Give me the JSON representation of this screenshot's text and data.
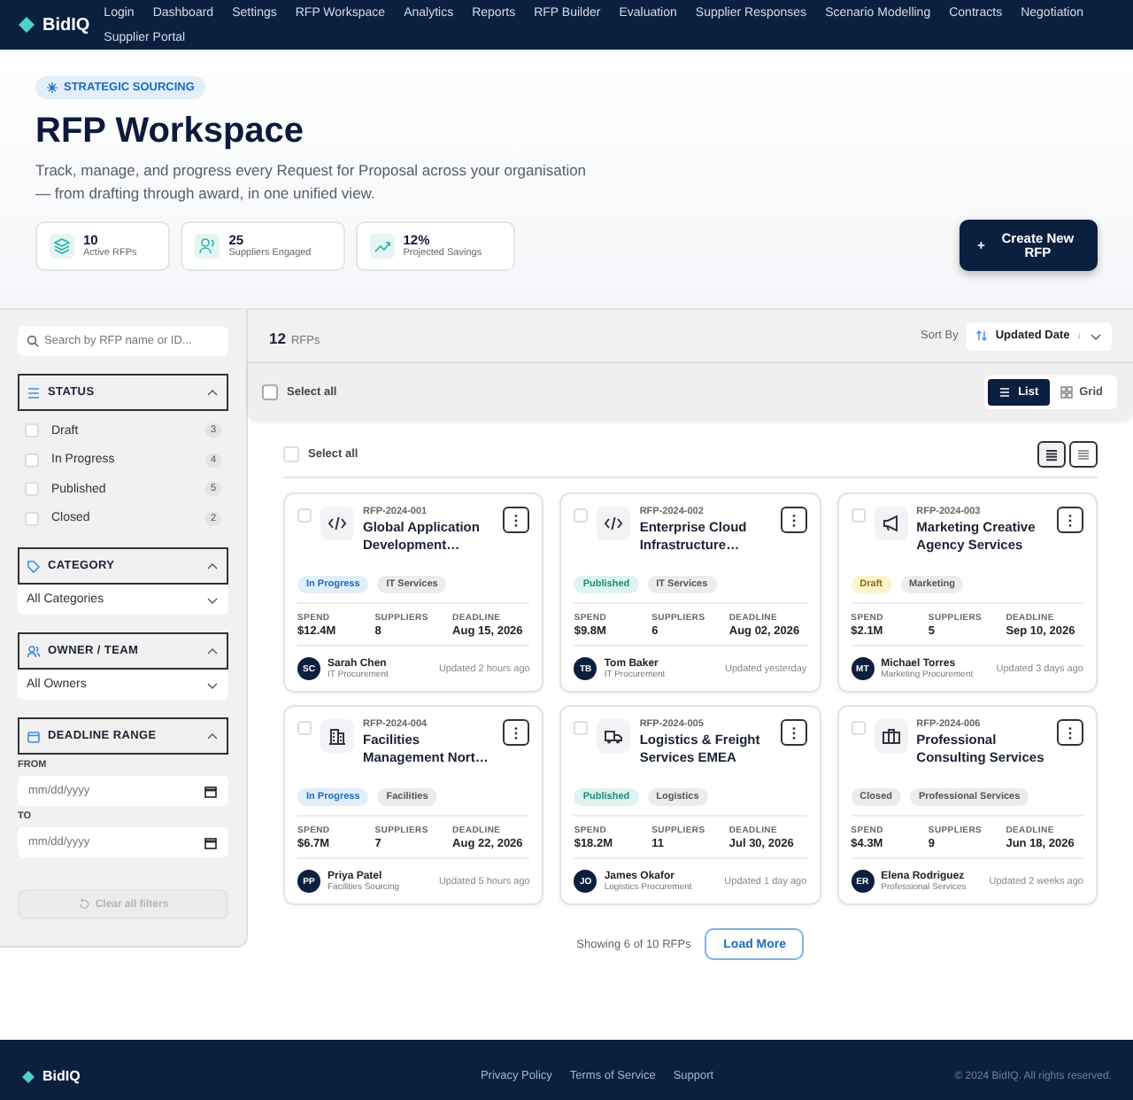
{
  "nav": {
    "brand": "BidIQ",
    "links": [
      "Login",
      "Dashboard",
      "Settings",
      "RFP Workspace",
      "Analytics",
      "Reports",
      "RFP Builder",
      "Evaluation",
      "Supplier Responses",
      "Scenario Modelling",
      "Contracts",
      "Negotiation",
      "Supplier Portal"
    ]
  },
  "hero": {
    "tag": "STRATEGIC SOURCING",
    "title": "RFP Workspace",
    "subtitle": "Track, manage, and progress every Request for Proposal across your organisation — from drafting through award, in one unified view.",
    "stats": [
      {
        "kind": "layers",
        "value": "10",
        "label": "Active RFPs"
      },
      {
        "kind": "user",
        "value": "25",
        "label": "Suppliers Engaged"
      },
      {
        "kind": "trend",
        "value": "12%",
        "label": "Projected Savings"
      }
    ],
    "create_button": {
      "icon": "+",
      "label": "Create New RFP"
    }
  },
  "sidebar": {
    "search": {
      "placeholder": "Search by RFP name or ID..."
    },
    "status": {
      "title": "STATUS",
      "expanded": true,
      "options": [
        {
          "label": "Draft",
          "count": "3",
          "checked": false
        },
        {
          "label": "In Progress",
          "count": "4",
          "checked": false
        },
        {
          "label": "Published",
          "count": "5",
          "checked": false
        },
        {
          "label": "Closed",
          "count": "2",
          "checked": false
        }
      ]
    },
    "category": {
      "title": "CATEGORY",
      "expanded": true,
      "value": "All Categories"
    },
    "owner": {
      "title": "OWNER / TEAM",
      "expanded": true,
      "value": "All Owners"
    },
    "deadline": {
      "title": "DEADLINE RANGE",
      "expanded": true,
      "from_label": "FROM",
      "from_placeholder": "mm/dd/yyyy",
      "to_label": "TO",
      "to_placeholder": "mm/dd/yyyy"
    },
    "clear_button": {
      "label": "Clear all filters",
      "disabled": true
    }
  },
  "toolbar": {
    "count": "12",
    "unit": "RFPs",
    "sort_label": "Sort By",
    "sort_value": "Updated Date",
    "sort_direction": "↓"
  },
  "bulk_bar": {
    "select_all": {
      "label": "Select all",
      "checked": false
    },
    "views": [
      {
        "label": "List",
        "selected": true
      },
      {
        "label": "Grid",
        "selected": false
      }
    ]
  },
  "list_header": {
    "select_all": {
      "label": "Select all",
      "checked": false
    },
    "density": [
      {
        "kind": "comfortable",
        "selected": true
      },
      {
        "kind": "compact",
        "selected": false
      }
    ]
  },
  "cards": [
    {
      "kind": "code",
      "checked": false,
      "id": "RFP-2024-001",
      "title": "Global Application Development…",
      "status": {
        "kind": "in_progress",
        "label": "In Progress"
      },
      "category": "IT Services",
      "stats": [
        {
          "label": "SPEND",
          "value": "$12.4M"
        },
        {
          "label": "SUPPLIERS",
          "value": "8"
        },
        {
          "label": "DEADLINE",
          "value": "Aug 15, 2026"
        }
      ],
      "owner": {
        "initials": "SC",
        "name": "Sarah Chen",
        "team": "IT Procurement"
      },
      "updated": "Updated 2 hours ago"
    },
    {
      "kind": "code",
      "checked": false,
      "id": "RFP-2024-002",
      "title": "Enterprise Cloud Infrastructure…",
      "status": {
        "kind": "published",
        "label": "Published"
      },
      "category": "IT Services",
      "stats": [
        {
          "label": "SPEND",
          "value": "$9.8M"
        },
        {
          "label": "SUPPLIERS",
          "value": "6"
        },
        {
          "label": "DEADLINE",
          "value": "Aug 02, 2026"
        }
      ],
      "owner": {
        "initials": "TB",
        "name": "Tom Baker",
        "team": "IT Procurement"
      },
      "updated": "Updated yesterday"
    },
    {
      "kind": "megaphone",
      "checked": false,
      "id": "RFP-2024-003",
      "title": "Marketing Creative Agency Services",
      "status": {
        "kind": "draft",
        "label": "Draft"
      },
      "category": "Marketing",
      "stats": [
        {
          "label": "SPEND",
          "value": "$2.1M"
        },
        {
          "label": "SUPPLIERS",
          "value": "5"
        },
        {
          "label": "DEADLINE",
          "value": "Sep 10, 2026"
        }
      ],
      "owner": {
        "initials": "MT",
        "name": "Michael Torres",
        "team": "Marketing Procurement"
      },
      "updated": "Updated 3 days ago"
    },
    {
      "kind": "building",
      "checked": false,
      "id": "RFP-2024-004",
      "title": "Facilities Management Nort…",
      "status": {
        "kind": "in_progress",
        "label": "In Progress"
      },
      "category": "Facilities",
      "stats": [
        {
          "label": "SPEND",
          "value": "$6.7M"
        },
        {
          "label": "SUPPLIERS",
          "value": "7"
        },
        {
          "label": "DEADLINE",
          "value": "Aug 22, 2026"
        }
      ],
      "owner": {
        "initials": "PP",
        "name": "Priya Patel",
        "team": "Facilities Sourcing"
      },
      "updated": "Updated 5 hours ago"
    },
    {
      "kind": "truck",
      "checked": false,
      "id": "RFP-2024-005",
      "title": "Logistics & Freight Services EMEA",
      "status": {
        "kind": "published",
        "label": "Published"
      },
      "category": "Logistics",
      "stats": [
        {
          "label": "SPEND",
          "value": "$18.2M"
        },
        {
          "label": "SUPPLIERS",
          "value": "11"
        },
        {
          "label": "DEADLINE",
          "value": "Jul 30, 2026"
        }
      ],
      "owner": {
        "initials": "JO",
        "name": "James Okafor",
        "team": "Logistics Procurement"
      },
      "updated": "Updated 1 day ago"
    },
    {
      "kind": "briefcase",
      "checked": false,
      "id": "RFP-2024-006",
      "title": "Professional Consulting Services",
      "status": {
        "kind": "closed",
        "label": "Closed"
      },
      "category": "Professional Services",
      "stats": [
        {
          "label": "SPEND",
          "value": "$4.3M"
        },
        {
          "label": "SUPPLIERS",
          "value": "9"
        },
        {
          "label": "DEADLINE",
          "value": "Jun 18, 2026"
        }
      ],
      "owner": {
        "initials": "ER",
        "name": "Elena Rodriguez",
        "team": "Professional Services"
      },
      "updated": "Updated 2 weeks ago"
    }
  ],
  "pager": {
    "summary": "Showing 6 of 10 RFPs",
    "load_more": "Load More"
  },
  "footer": {
    "brand": "BidIQ",
    "links": [
      "Privacy Policy",
      "Terms of Service",
      "Support"
    ],
    "copyright": "© 2024 BidIQ. All rights reserved."
  }
}
